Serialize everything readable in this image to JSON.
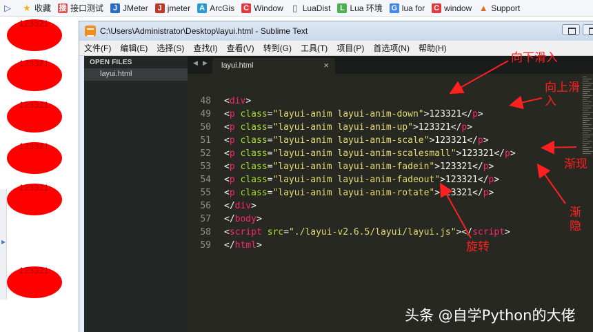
{
  "bookmarks": [
    {
      "label": "",
      "icon": "tab-list-icon"
    },
    {
      "label": "收藏",
      "icon": "star-icon"
    },
    {
      "label": "接口测试",
      "icon": "api-test-icon"
    },
    {
      "label": "JMeter",
      "icon": "jmeter-icon"
    },
    {
      "label": "jmeter",
      "icon": "jmeter-red-icon"
    },
    {
      "label": "ArcGis",
      "icon": "arcgis-icon"
    },
    {
      "label": "Window",
      "icon": "csdn-icon"
    },
    {
      "label": "LuaDist",
      "icon": "page-icon"
    },
    {
      "label": "Lua 环境",
      "icon": "lua-icon"
    },
    {
      "label": "lua for",
      "icon": "google-icon"
    },
    {
      "label": "window",
      "icon": "csdn-icon"
    },
    {
      "label": "Support",
      "icon": "support-icon"
    }
  ],
  "left_pane": {
    "ovals": [
      "123321",
      "123321",
      "123321",
      "123321",
      "123321",
      "123321"
    ]
  },
  "window": {
    "title": "C:\\Users\\Administrator\\Desktop\\layui.html - Sublime Text",
    "menu": [
      "文件(F)",
      "编辑(E)",
      "选择(S)",
      "查找(I)",
      "查看(V)",
      "转到(G)",
      "工具(T)",
      "项目(P)",
      "首选项(N)",
      "帮助(H)"
    ]
  },
  "sidebar": {
    "header": "OPEN FILES",
    "files": [
      "layui.html"
    ]
  },
  "tabs": {
    "prev_icon": "◀",
    "next_icon": "▶",
    "active": {
      "label": "layui.html",
      "close": "×"
    }
  },
  "editor": {
    "lines": [
      {
        "n": "48",
        "tag": "div",
        "kind": "open"
      },
      {
        "n": "49",
        "attr": "class",
        "value": "\"layui-anim layui-anim-down\"",
        "text": "123321",
        "kind": "p"
      },
      {
        "n": "50",
        "attr": "class",
        "value": "\"layui-anim layui-anim-up\"",
        "text": "123321",
        "kind": "p"
      },
      {
        "n": "51",
        "attr": "class",
        "value": "\"layui-anim layui-anim-scale\"",
        "text": "123321",
        "kind": "p"
      },
      {
        "n": "52",
        "attr": "class",
        "value": "\"layui-anim layui-anim-scalesmall\"",
        "text": "123321",
        "kind": "p"
      },
      {
        "n": "53",
        "attr": "class",
        "value": "\"layui-anim layui-anim-fadein\"",
        "text": "123321",
        "kind": "p"
      },
      {
        "n": "54",
        "attr": "class",
        "value": "\"layui-anim layui-anim-fadeout\"",
        "text": "123321",
        "kind": "p"
      },
      {
        "n": "55",
        "attr": "class",
        "value": "\"layui-anim layui-anim-rotate\"",
        "text": "123321",
        "kind": "p"
      },
      {
        "n": "56",
        "tag": "div",
        "kind": "close"
      },
      {
        "n": "57",
        "tag": "body",
        "kind": "close"
      },
      {
        "n": "58",
        "attr": "src",
        "value": "\"./layui-v2.6.5/layui/layui.js\"",
        "kind": "script"
      },
      {
        "n": "59",
        "tag": "html",
        "kind": "close"
      }
    ]
  },
  "annotations": {
    "down": "向下滑入",
    "up_1": "向上滑",
    "up_2": "入",
    "fadein": "渐现",
    "fadeout_1": "渐",
    "fadeout_2": "隐",
    "rotate": "旋转",
    "color": "#ff2020"
  },
  "watermark": "头条 @自学Python的大佬",
  "colors": {
    "editor_bg": "#272822",
    "tag": "#f92672",
    "attr": "#a6e22e",
    "string": "#e6db74",
    "plain": "#f8f8f2",
    "oval": "#ff0000"
  }
}
